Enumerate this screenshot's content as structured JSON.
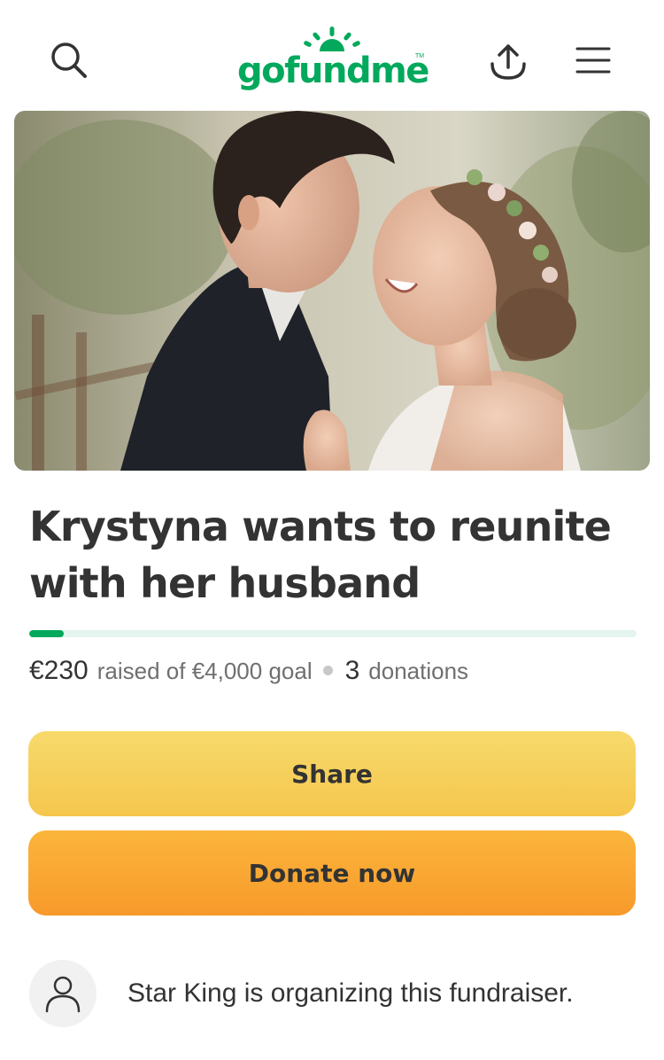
{
  "header": {
    "logo_text": "gofundme",
    "logo_tm": "TM",
    "icons": {
      "search": "search-icon",
      "share": "upload-share-icon",
      "menu": "hamburger-menu-icon"
    },
    "brand_color": "#02a95c"
  },
  "hero": {
    "image": "couple-photo"
  },
  "campaign": {
    "title": "Krystyna wants to reunite with her husband",
    "raised_amount": "€230",
    "raised_text": "raised of €4,000 goal",
    "donation_count": "3",
    "donations_label": "donations",
    "progress_fraction": 0.0575
  },
  "actions": {
    "share_label": "Share",
    "donate_label": "Donate now"
  },
  "organizer": {
    "text": "Star King is organizing this fundraiser.",
    "avatar_icon": "user-icon"
  }
}
